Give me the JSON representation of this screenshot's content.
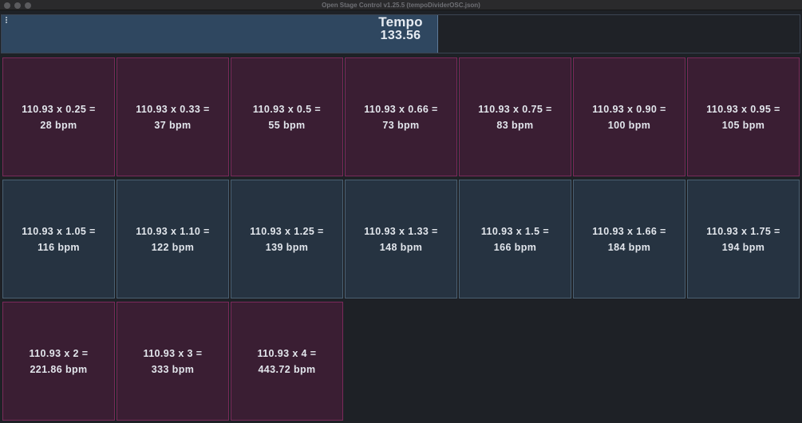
{
  "window": {
    "title": "Open Stage Control v1.25.5 (tempoDividerOSC.json)"
  },
  "tempo": {
    "label": "Tempo",
    "value": "133.56"
  },
  "colors": {
    "pink_bg": "#3a1e33",
    "pink_border": "#7a2a5a",
    "blue_bg": "#263341",
    "blue_border": "#4a6072",
    "tempo_fill": "#2f4760"
  },
  "buttons": [
    {
      "formula": "110.93 x 0.25 =",
      "result": "28 bpm"
    },
    {
      "formula": "110.93 x 0.33 =",
      "result": "37 bpm"
    },
    {
      "formula": "110.93 x 0.5 =",
      "result": "55 bpm"
    },
    {
      "formula": "110.93 x 0.66 =",
      "result": "73 bpm"
    },
    {
      "formula": "110.93 x 0.75 =",
      "result": "83 bpm"
    },
    {
      "formula": "110.93 x 0.90 =",
      "result": "100 bpm"
    },
    {
      "formula": "110.93 x 0.95 =",
      "result": "105 bpm"
    },
    {
      "formula": "110.93 x 1.05 =",
      "result": "116 bpm"
    },
    {
      "formula": "110.93 x 1.10 =",
      "result": "122 bpm"
    },
    {
      "formula": "110.93 x 1.25 =",
      "result": "139 bpm"
    },
    {
      "formula": "110.93 x 1.33 =",
      "result": "148 bpm"
    },
    {
      "formula": "110.93 x 1.5 =",
      "result": "166 bpm"
    },
    {
      "formula": "110.93 x 1.66 =",
      "result": "184 bpm"
    },
    {
      "formula": "110.93 x 1.75 =",
      "result": "194 bpm"
    },
    {
      "formula": "110.93 x 2 =",
      "result": "221.86 bpm"
    },
    {
      "formula": "110.93 x 3 =",
      "result": "333 bpm"
    },
    {
      "formula": "110.93 x 4 =",
      "result": "443.72 bpm"
    }
  ]
}
